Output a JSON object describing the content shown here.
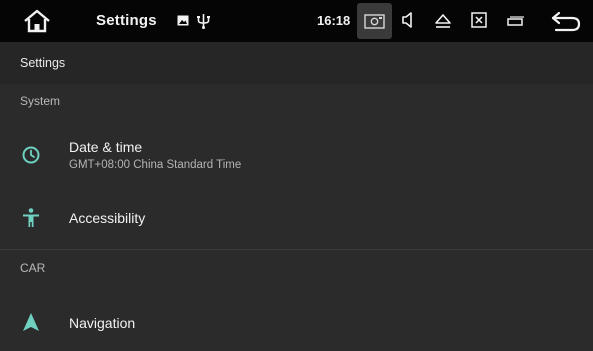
{
  "status_bar": {
    "title": "Settings",
    "time": "16:18",
    "icons": [
      "home-icon",
      "image-notification-icon",
      "usb-icon",
      "screenshot-icon",
      "volume-icon",
      "eject-icon",
      "close-window-icon",
      "multi-window-icon",
      "back-icon"
    ]
  },
  "app_bar": {
    "title": "Settings"
  },
  "sections": {
    "system": {
      "header": "System",
      "items": [
        {
          "label": "Date & time",
          "summary": "GMT+08:00 China Standard Time",
          "icon": "clock-icon"
        },
        {
          "label": "Accessibility",
          "icon": "accessibility-icon"
        }
      ]
    },
    "car": {
      "header": "CAR",
      "items": [
        {
          "label": "Navigation",
          "icon": "navigation-icon"
        }
      ]
    }
  },
  "colors": {
    "accent": "#6fd1c0",
    "background": "#2b2b2b",
    "status_bar": "#050505"
  }
}
